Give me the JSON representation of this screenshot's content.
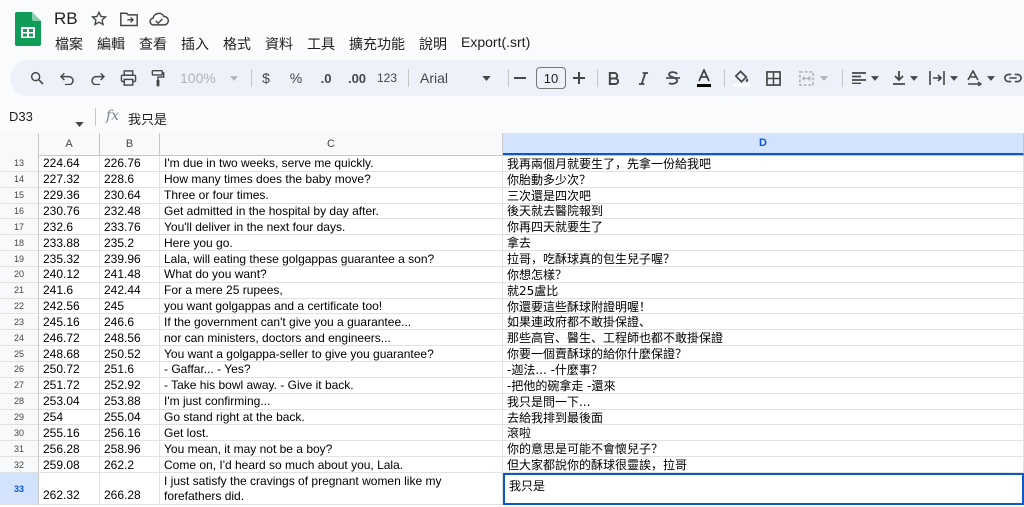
{
  "doc": {
    "title": "RB"
  },
  "menu": [
    "檔案",
    "編輯",
    "查看",
    "插入",
    "格式",
    "資料",
    "工具",
    "擴充功能",
    "說明",
    "Export(.srt)"
  ],
  "toolbar": {
    "zoom": "100%",
    "currency": "$",
    "percent": "%",
    "dec_decrease": ".0",
    "dec_increase": ".00",
    "number_format": "123",
    "font": "Arial",
    "font_size": "10"
  },
  "formula_bar": {
    "cell_ref": "D33",
    "fx": "fx",
    "value": "我只是"
  },
  "columns": [
    "A",
    "B",
    "C",
    "D"
  ],
  "selected_column": "D",
  "rows": [
    {
      "num": "13",
      "a": "224.64",
      "b": "226.76",
      "c": "I'm due in two weeks, serve me quickly.",
      "d": "我再兩個月就要生了，先拿一份給我吧"
    },
    {
      "num": "14",
      "a": "227.32",
      "b": "228.6",
      "c": "How many times does the baby move?",
      "d": "你胎動多少次？"
    },
    {
      "num": "15",
      "a": "229.36",
      "b": "230.64",
      "c": "Three or four times.",
      "d": "三次還是四次吧"
    },
    {
      "num": "16",
      "a": "230.76",
      "b": "232.48",
      "c": "Get admitted in the hospital by day after.",
      "d": "後天就去醫院報到"
    },
    {
      "num": "17",
      "a": "232.6",
      "b": "233.76",
      "c": "You'll deliver in the next four days.",
      "d": "你再四天就要生了"
    },
    {
      "num": "18",
      "a": "233.88",
      "b": "235.2",
      "c": "Here you go.",
      "d": "拿去"
    },
    {
      "num": "19",
      "a": "235.32",
      "b": "239.96",
      "c": "Lala, will eating these golgappas guarantee a son?",
      "d": "拉哥，吃酥球真的包生兒子喔？"
    },
    {
      "num": "20",
      "a": "240.12",
      "b": "241.48",
      "c": "What do you want?",
      "d": "你想怎樣？"
    },
    {
      "num": "21",
      "a": "241.6",
      "b": "242.44",
      "c": "For a mere 25 rupees,",
      "d": "就25盧比"
    },
    {
      "num": "22",
      "a": "242.56",
      "b": "245",
      "c": "you want golgappas and a certificate too!",
      "d": "你還要這些酥球附證明喔！"
    },
    {
      "num": "23",
      "a": "245.16",
      "b": "246.6",
      "c": "If the government can't give you a guarantee...",
      "d": "如果連政府都不敢掛保證、"
    },
    {
      "num": "24",
      "a": "246.72",
      "b": "248.56",
      "c": "nor can ministers, doctors and engineers...",
      "d": "那些高官、醫生、工程師也都不敢掛保證"
    },
    {
      "num": "25",
      "a": "248.68",
      "b": "250.52",
      "c": "You want a golgappa-seller to give you guarantee?",
      "d": "你要一個賣酥球的給你什麼保證？"
    },
    {
      "num": "26",
      "a": "250.72",
      "b": "251.6",
      "c": "- Gaffar... - Yes?",
      "d": "-迦法... -什麼事？"
    },
    {
      "num": "27",
      "a": "251.72",
      "b": "252.92",
      "c": "- Take his bowl away. - Give it back.",
      "d": "-把他的碗拿走 -還來"
    },
    {
      "num": "28",
      "a": "253.04",
      "b": "253.88",
      "c": "I'm just confirming...",
      "d": "我只是問一下..."
    },
    {
      "num": "29",
      "a": "254",
      "b": "255.04",
      "c": "Go stand right at the back.",
      "d": "去給我排到最後面"
    },
    {
      "num": "30",
      "a": "255.16",
      "b": "256.16",
      "c": "Get lost.",
      "d": "滾啦"
    },
    {
      "num": "31",
      "a": "256.28",
      "b": "258.96",
      "c": "You mean, it may not be a boy?",
      "d": "你的意思是可能不會懷兒子？"
    },
    {
      "num": "32",
      "a": "259.08",
      "b": "262.2",
      "c": "Come on, I'd heard so much about you, Lala.",
      "d": "但大家都說你的酥球很靈誒，拉哥"
    },
    {
      "num": "33",
      "a": "262.32",
      "b": "266.28",
      "c": "I just satisfy the cravings of pregnant women like my forefathers did.",
      "d": "我只是"
    }
  ],
  "accent_color": "#0b57d0"
}
